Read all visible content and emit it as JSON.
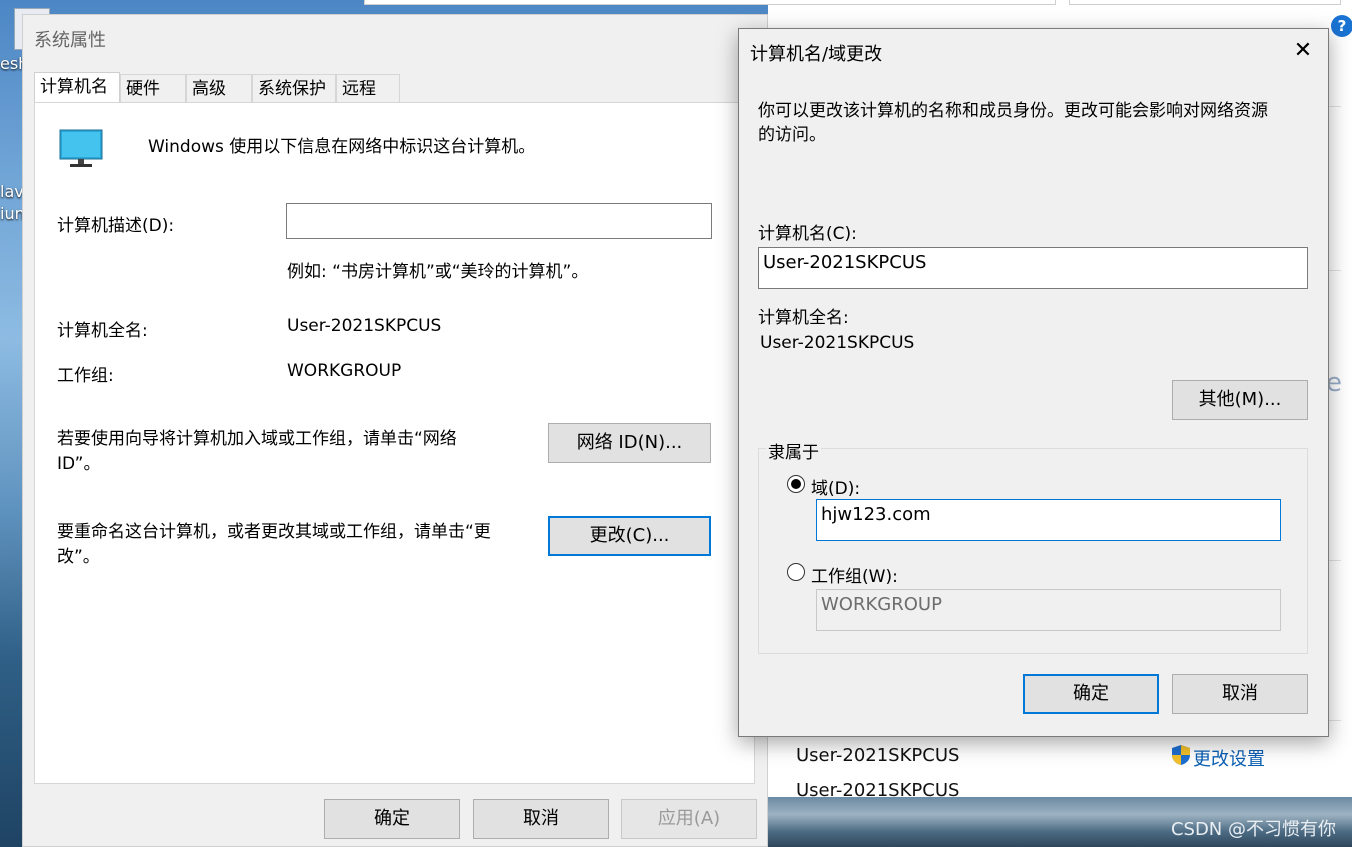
{
  "desktop": {
    "labels": [
      "esh",
      "lav",
      "iun"
    ]
  },
  "background_window": {
    "computer_name_1": "User-2021SKPCUS",
    "computer_name_2": "User-2021SKPCUS",
    "change_settings_link": "更改设置",
    "help_icon": "?",
    "edge_fragment": "e",
    "watermark": "CSDN @不习惯有你"
  },
  "system_properties": {
    "title": "系统属性",
    "tabs": [
      "计算机名",
      "硬件",
      "高级",
      "系统保护",
      "远程"
    ],
    "intro": "Windows 使用以下信息在网络中标识这台计算机。",
    "description_label": "计算机描述(D):",
    "description_value": "",
    "example": "例如: “书房计算机”或“美玲的计算机”。",
    "full_name_label": "计算机全名:",
    "full_name_value": "User-2021SKPCUS",
    "workgroup_label": "工作组:",
    "workgroup_value": "WORKGROUP",
    "network_id_text_1": "若要使用向导将计算机加入域或工作组，请单击“网络",
    "network_id_text_2": "ID”。",
    "network_id_button": "网络 ID(N)...",
    "rename_text_1": "要重命名这台计算机，或者更改其域或工作组，请单击“更",
    "rename_text_2": "改”。",
    "change_button": "更改(C)...",
    "ok_button": "确定",
    "cancel_button": "取消",
    "apply_button": "应用(A)"
  },
  "rename_dialog": {
    "title": "计算机名/域更改",
    "close_icon": "✕",
    "intro_1": "你可以更改该计算机的名称和成员身份。更改可能会影响对网络资源",
    "intro_2": "的访问。",
    "computer_name_label": "计算机名(C):",
    "computer_name_value": "User-2021SKPCUS",
    "full_name_label": "计算机全名:",
    "full_name_value": "User-2021SKPCUS",
    "more_button": "其他(M)...",
    "member_of_label": "隶属于",
    "domain_label": "域(D):",
    "domain_selected": true,
    "domain_value": "hjw123.com",
    "workgroup_label": "工作组(W):",
    "workgroup_value": "WORKGROUP",
    "ok_button": "确定",
    "cancel_button": "取消"
  }
}
